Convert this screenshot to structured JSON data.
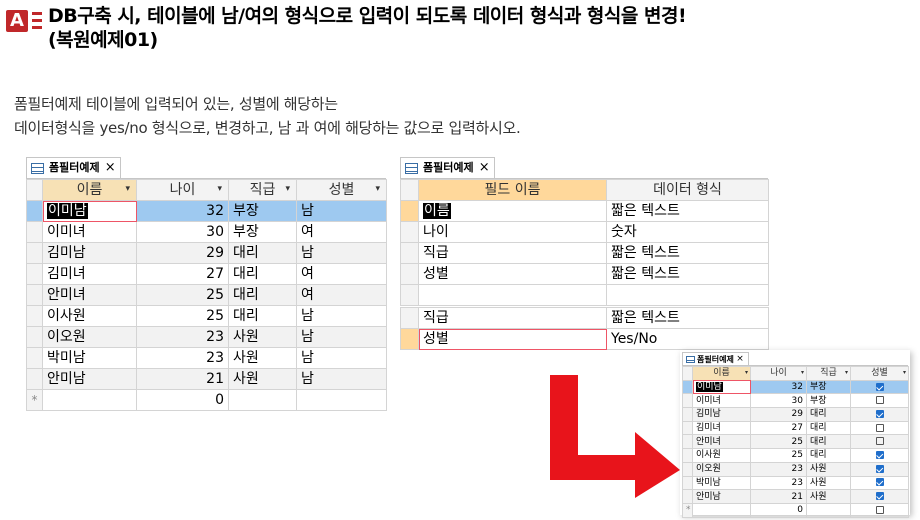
{
  "header": {
    "app_icon_letter": "A",
    "title_line1": "DB구축 시, 테이블에 남/여의 형식으로 입력이 되도록 데이터 형식과 형식을 변경!",
    "title_line2": "(복원예제01)"
  },
  "instructions": {
    "line1": "폼필터예제 테이블에 입력되어 있는, 성별에 해당하는",
    "line2": "데이터형식을 yes/no 형식으로, 변경하고, 남 과 여에 해당하는 값으로 입력하시오."
  },
  "datasheet": {
    "tab_label": "폼필터예제",
    "close_glyph": "×",
    "columns": [
      "이름",
      "나이",
      "직급",
      "성별"
    ],
    "rows": [
      {
        "name": "이미남",
        "age": "32",
        "rank": "부장",
        "gender": "남"
      },
      {
        "name": "이미녀",
        "age": "30",
        "rank": "부장",
        "gender": "여"
      },
      {
        "name": "김미남",
        "age": "29",
        "rank": "대리",
        "gender": "남"
      },
      {
        "name": "김미녀",
        "age": "27",
        "rank": "대리",
        "gender": "여"
      },
      {
        "name": "안미녀",
        "age": "25",
        "rank": "대리",
        "gender": "여"
      },
      {
        "name": "이사원",
        "age": "25",
        "rank": "대리",
        "gender": "남"
      },
      {
        "name": "이오원",
        "age": "23",
        "rank": "사원",
        "gender": "남"
      },
      {
        "name": "박미남",
        "age": "23",
        "rank": "사원",
        "gender": "남"
      },
      {
        "name": "안미남",
        "age": "21",
        "rank": "사원",
        "gender": "남"
      }
    ],
    "new_row_marker": "*",
    "new_row_age": "0"
  },
  "design": {
    "tab_label": "폼필터예제",
    "close_glyph": "×",
    "col_field": "필드 이름",
    "col_type": "데이터 형식",
    "fields": [
      {
        "name": "이름",
        "type": "짧은 텍스트"
      },
      {
        "name": "나이",
        "type": "숫자"
      },
      {
        "name": "직급",
        "type": "짧은 텍스트"
      },
      {
        "name": "성별",
        "type": "짧은 텍스트"
      }
    ],
    "changed": [
      {
        "name": "직급",
        "type": "짧은 텍스트"
      },
      {
        "name": "성별",
        "type": "Yes/No"
      }
    ]
  },
  "result": {
    "tab_label": "폼필터예제",
    "close_glyph": "×",
    "columns": [
      "이름",
      "나이",
      "직급",
      "성별"
    ],
    "rows": [
      {
        "name": "이미남",
        "age": "32",
        "rank": "부장",
        "checked": true
      },
      {
        "name": "이미녀",
        "age": "30",
        "rank": "부장",
        "checked": false
      },
      {
        "name": "김미남",
        "age": "29",
        "rank": "대리",
        "checked": true
      },
      {
        "name": "김미녀",
        "age": "27",
        "rank": "대리",
        "checked": false
      },
      {
        "name": "안미녀",
        "age": "25",
        "rank": "대리",
        "checked": false
      },
      {
        "name": "이사원",
        "age": "25",
        "rank": "대리",
        "checked": true
      },
      {
        "name": "이오원",
        "age": "23",
        "rank": "사원",
        "checked": true
      },
      {
        "name": "박미남",
        "age": "23",
        "rank": "사원",
        "checked": true
      },
      {
        "name": "안미남",
        "age": "21",
        "rank": "사원",
        "checked": true
      }
    ],
    "new_row_marker": "*",
    "new_row_age": "0"
  },
  "colors": {
    "accent_red": "#c0282a",
    "arrow_red": "#e8141b",
    "selected_row": "#9ec9f0",
    "design_header": "#ffd89b",
    "checkbox_blue": "#1f6ecb"
  }
}
